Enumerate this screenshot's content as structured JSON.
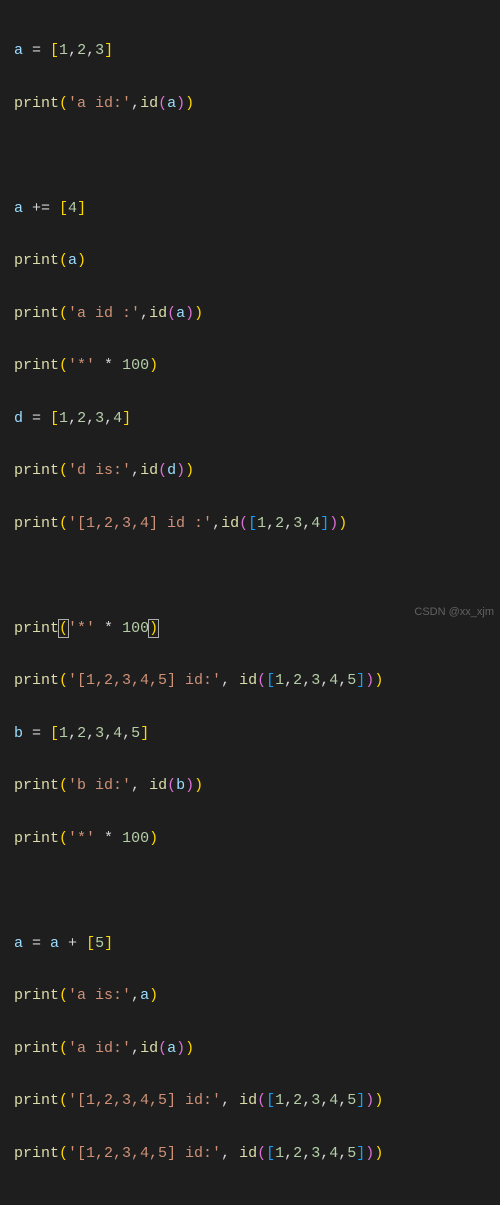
{
  "code": {
    "line1": {
      "a": "a",
      "eq": " = ",
      "lb": "[",
      "n1": "1",
      "c": ",",
      "n2": "2",
      "n3": "3",
      "rb": "]"
    },
    "line2": {
      "fn": "print",
      "lp": "(",
      "s": "'a id:'",
      "c": ",",
      "id": "id",
      "lp2": "(",
      "v": "a",
      "rp2": ")",
      "rp": ")"
    },
    "line4": {
      "a": "a",
      "op": " += ",
      "lb": "[",
      "n": "4",
      "rb": "]"
    },
    "line5": {
      "fn": "print",
      "lp": "(",
      "v": "a",
      "rp": ")"
    },
    "line6": {
      "fn": "print",
      "lp": "(",
      "s": "'a id :'",
      "c": ",",
      "id": "id",
      "lp2": "(",
      "v": "a",
      "rp2": ")",
      "rp": ")"
    },
    "line7": {
      "fn": "print",
      "lp": "(",
      "s": "'*'",
      "op": " * ",
      "n": "100",
      "rp": ")"
    },
    "line8": {
      "d": "d",
      "eq": " = ",
      "lb": "[",
      "n1": "1",
      "c": ",",
      "n2": "2",
      "n3": "3",
      "n4": "4",
      "rb": "]"
    },
    "line9": {
      "fn": "print",
      "lp": "(",
      "s": "'d is:'",
      "c": ",",
      "id": "id",
      "lp2": "(",
      "v": "d",
      "rp2": ")",
      "rp": ")"
    },
    "line10": {
      "fn": "print",
      "lp": "(",
      "s": "'[1,2,3,4] id :'",
      "c": ",",
      "id": "id",
      "lp2": "(",
      "lb": "[",
      "n1": "1",
      "cm": ",",
      "n2": "2",
      "n3": "3",
      "n4": "4",
      "rb": "]",
      "rp2": ")",
      "rp": ")"
    },
    "line12": {
      "fn": "print",
      "lp": "(",
      "s": "'*'",
      "op": " * ",
      "n": "100",
      "rp": ")"
    },
    "line13": {
      "fn": "print",
      "lp": "(",
      "s": "'[1,2,3,4,5] id:'",
      "c": ",",
      "sp": " ",
      "id": "id",
      "lp2": "(",
      "lb": "[",
      "n1": "1",
      "cm": ",",
      "n2": "2",
      "n3": "3",
      "n4": "4",
      "n5": "5",
      "rb": "]",
      "rp2": ")",
      "rp": ")"
    },
    "line14": {
      "b": "b",
      "eq": " = ",
      "lb": "[",
      "n1": "1",
      "c": ",",
      "n2": "2",
      "n3": "3",
      "n4": "4",
      "n5": "5",
      "rb": "]"
    },
    "line15": {
      "fn": "print",
      "lp": "(",
      "s": "'b id:'",
      "c": ",",
      "sp": " ",
      "id": "id",
      "lp2": "(",
      "v": "b",
      "rp2": ")",
      "rp": ")"
    },
    "line16": {
      "fn": "print",
      "lp": "(",
      "s": "'*'",
      "op": " * ",
      "n": "100",
      "rp": ")"
    },
    "line18": {
      "a": "a",
      "eq": " = ",
      "a2": "a",
      "op": " + ",
      "lb": "[",
      "n": "5",
      "rb": "]"
    },
    "line19": {
      "fn": "print",
      "lp": "(",
      "s": "'a is:'",
      "c": ",",
      "v": "a",
      "rp": ")"
    },
    "line20": {
      "fn": "print",
      "lp": "(",
      "s": "'a id:'",
      "c": ",",
      "id": "id",
      "lp2": "(",
      "v": "a",
      "rp2": ")",
      "rp": ")"
    },
    "line21": {
      "fn": "print",
      "lp": "(",
      "s": "'[1,2,3,4,5] id:'",
      "c": ",",
      "sp": " ",
      "id": "id",
      "lp2": "(",
      "lb": "[",
      "n1": "1",
      "cm": ",",
      "n2": "2",
      "n3": "3",
      "n4": "4",
      "n5": "5",
      "rb": "]",
      "rp2": ")",
      "rp": ")"
    },
    "line22": {
      "fn": "print",
      "lp": "(",
      "s": "'[1,2,3,4,5] id:'",
      "c": ",",
      "sp": " ",
      "id": "id",
      "lp2": "(",
      "lb": "[",
      "n1": "1",
      "cm": ",",
      "n2": "2",
      "n3": "3",
      "n4": "4",
      "n5": "5",
      "rb": "]",
      "rp2": ")",
      "rp": ")"
    }
  },
  "watermark": "CSDN @xx_xjm"
}
